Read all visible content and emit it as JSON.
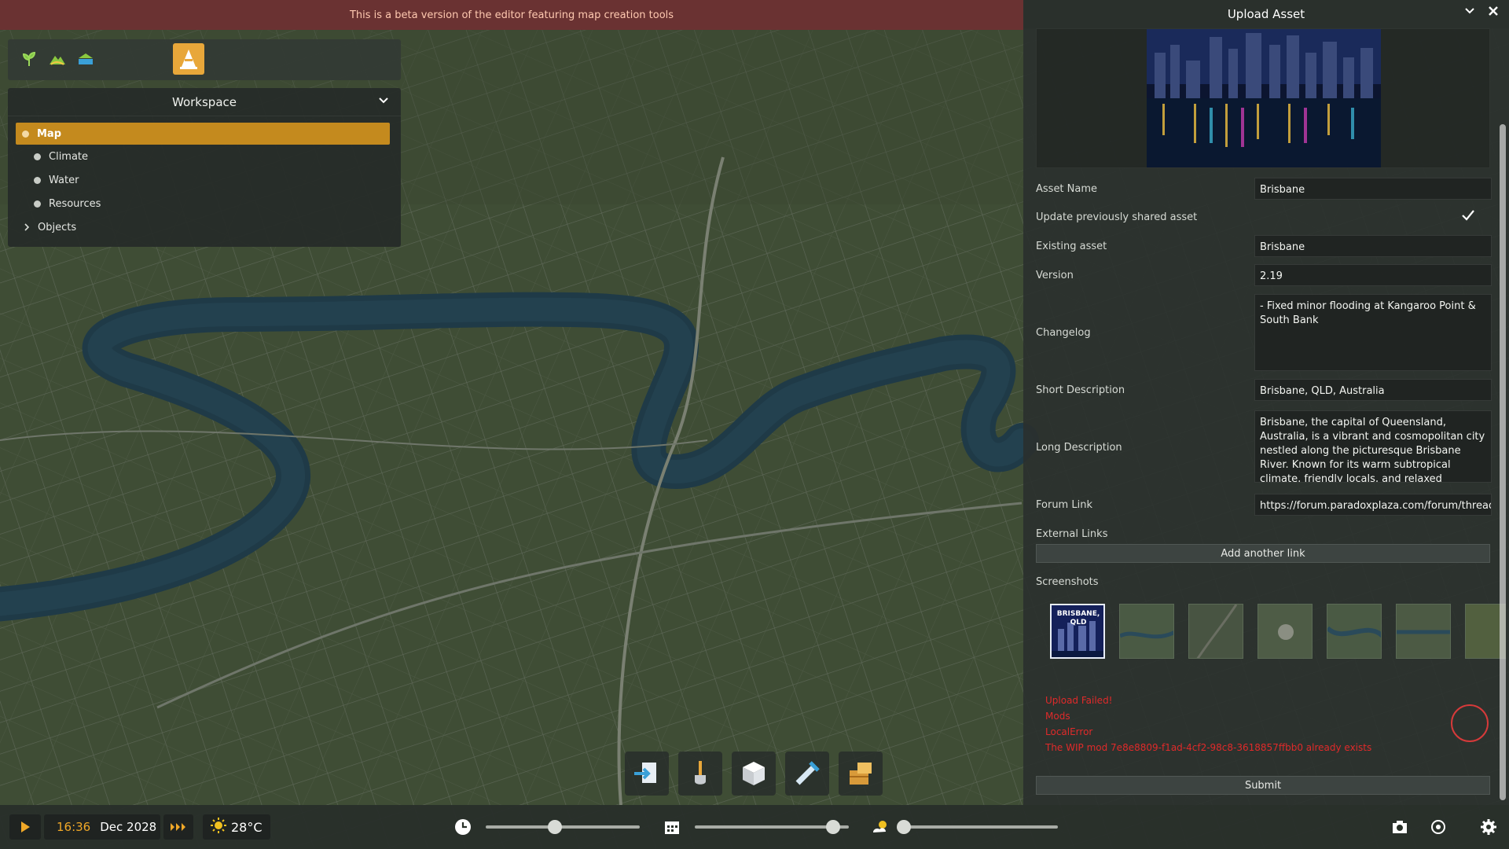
{
  "banner": {
    "text": "This is a beta version of the editor featuring map creation tools"
  },
  "toolbar": {
    "icons": [
      "sprout-icon",
      "terrain-icon",
      "water-icon"
    ],
    "active_icon": "warning-cone-icon"
  },
  "workspace": {
    "title": "Workspace",
    "items": [
      {
        "label": "Map",
        "active": true
      },
      {
        "label": "Climate"
      },
      {
        "label": "Water"
      },
      {
        "label": "Resources"
      }
    ],
    "objects_label": "Objects"
  },
  "panel": {
    "title": "Upload Asset",
    "fields": {
      "asset_name_label": "Asset Name",
      "asset_name_value": "Brisbane",
      "update_label": "Update previously shared asset",
      "update_checked": true,
      "existing_label": "Existing asset",
      "existing_value": "Brisbane",
      "version_label": "Version",
      "version_value": "2.19",
      "changelog_label": "Changelog",
      "changelog_value": "- Fixed minor flooding at Kangaroo Point & South Bank",
      "short_desc_label": "Short Description",
      "short_desc_value": "Brisbane, QLD, Australia",
      "long_desc_label": "Long Description",
      "long_desc_value": "Brisbane, the capital of Queensland, Australia, is a vibrant and cosmopolitan city nestled along the picturesque Brisbane River. Known for its warm subtropical climate, friendly locals, and relaxed atmosphere, Brisbane offers a perfect blend of",
      "forum_label": "Forum Link",
      "forum_value": "https://forum.paradoxplaza.com/forum/threads/",
      "external_links_label": "External Links",
      "add_link_label": "Add another link",
      "screenshots_label": "Screenshots"
    },
    "screenshot_thumb_text": "BRISBANE, QLD",
    "errors": [
      "Upload Failed!",
      "Mods",
      "LocalError",
      "The WIP mod 7e8e8809-f1ad-4cf2-98c8-3618857ffbb0 already exists"
    ],
    "submit_label": "Submit"
  },
  "bottom_bar": {
    "time": "16:36",
    "date": "Dec 2028",
    "temperature": "28°C",
    "time_slider": 0.45,
    "date_slider": 0.9,
    "weather_slider": 0.0,
    "icons": [
      "play-icon",
      "fast-forward-icon",
      "sun-icon",
      "clock-icon",
      "calendar-icon",
      "weather-icon",
      "camera-icon",
      "target-icon",
      "gear-icon"
    ]
  },
  "tools": [
    "import-icon",
    "shovel-icon",
    "cube-icon",
    "pipe-tool-icon",
    "crate-icon"
  ],
  "colors": {
    "accent": "#c48a1e",
    "active_tool": "#e8a73a",
    "error": "#e02a2a",
    "banner_bg": "#6a3232"
  }
}
